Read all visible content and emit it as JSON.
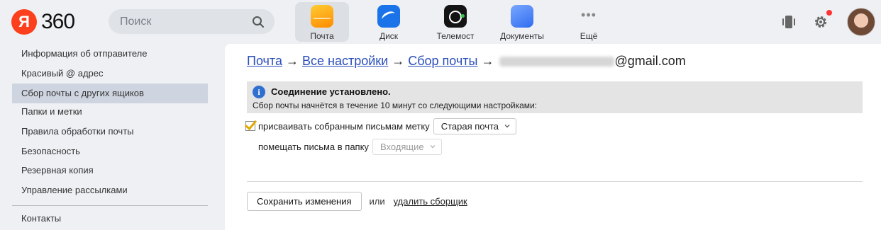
{
  "header": {
    "logo_letter": "Я",
    "logo_text": "360",
    "search_placeholder": "Поиск",
    "apps": [
      {
        "label": "Почта",
        "icon": "mail-icon"
      },
      {
        "label": "Диск",
        "icon": "disk-icon"
      },
      {
        "label": "Телемост",
        "icon": "telemost-icon"
      },
      {
        "label": "Документы",
        "icon": "documents-icon"
      },
      {
        "label": "Ещё",
        "icon": "more-dots-icon"
      }
    ],
    "more_glyph": "•••"
  },
  "sidebar": {
    "items": [
      {
        "label": "Информация об отправителе"
      },
      {
        "label": "Красивый @ адрес"
      },
      {
        "label": "Сбор почты с других ящиков"
      },
      {
        "label": "Папки и метки"
      },
      {
        "label": "Правила обработки почты"
      },
      {
        "label": "Безопасность"
      },
      {
        "label": "Резервная копия"
      },
      {
        "label": "Управление рассылками"
      },
      {
        "label": "Контакты"
      }
    ],
    "active_index": 2
  },
  "breadcrumb": {
    "items": [
      "Почта",
      "Все настройки",
      "Сбор почты"
    ],
    "arrow": "→",
    "email_suffix": "@gmail.com"
  },
  "notice": {
    "title": "Соединение установлено.",
    "text": "Сбор почты начнётся в течение 10 минут со следующими настройками:"
  },
  "settings": {
    "label_option": "присваивать собранным письмам метку",
    "label_checked": true,
    "label_value": "Старая почта",
    "folder_option": "помещать письма в папку",
    "folder_value": "Входящие"
  },
  "actions": {
    "save_label": "Сохранить изменения",
    "or_text": "или",
    "delete_label": "удалить сборщик"
  },
  "colors": {
    "accent_link": "#2a4ebb",
    "logo_red": "#fc3f1d",
    "notification": "#ff3333",
    "sidebar_active": "#cfd5e0"
  }
}
